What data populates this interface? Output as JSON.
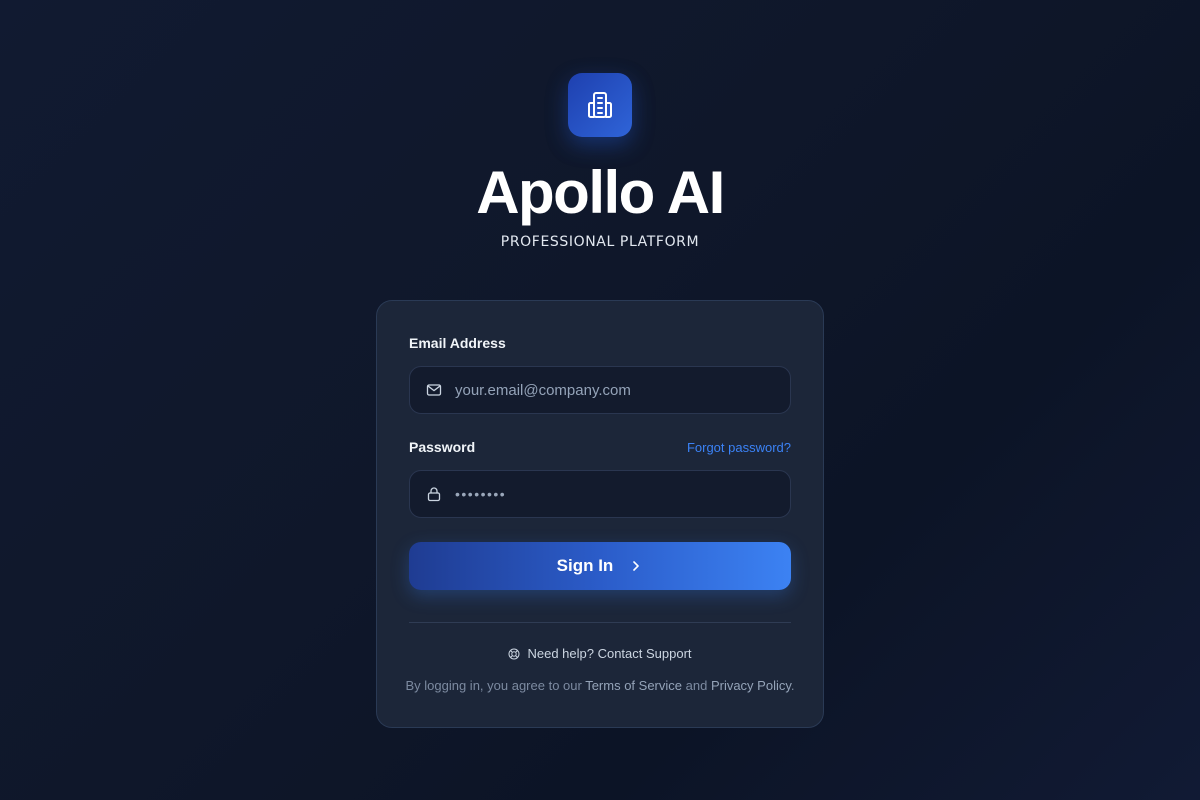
{
  "brand": {
    "title": "Apollo AI",
    "subtitle": "PROFESSIONAL PLATFORM",
    "logo_icon": "building-icon",
    "accent_color": "#3b82f6"
  },
  "form": {
    "email_label": "Email Address",
    "email_placeholder": "your.email@company.com",
    "email_icon": "mail-icon",
    "password_label": "Password",
    "forgot_label": "Forgot password?",
    "password_value": "••••••••",
    "password_icon": "lock-icon",
    "signin_label": "Sign In",
    "signin_icon": "chevron-right-icon"
  },
  "footer": {
    "help_text": "Need help? Contact Support",
    "help_icon": "lifebuoy-icon",
    "terms_prefix": "By logging in, you agree to our ",
    "terms_link": "Terms of Service",
    "terms_and": " and ",
    "privacy_link": "Privacy Policy",
    "terms_suffix": "."
  }
}
